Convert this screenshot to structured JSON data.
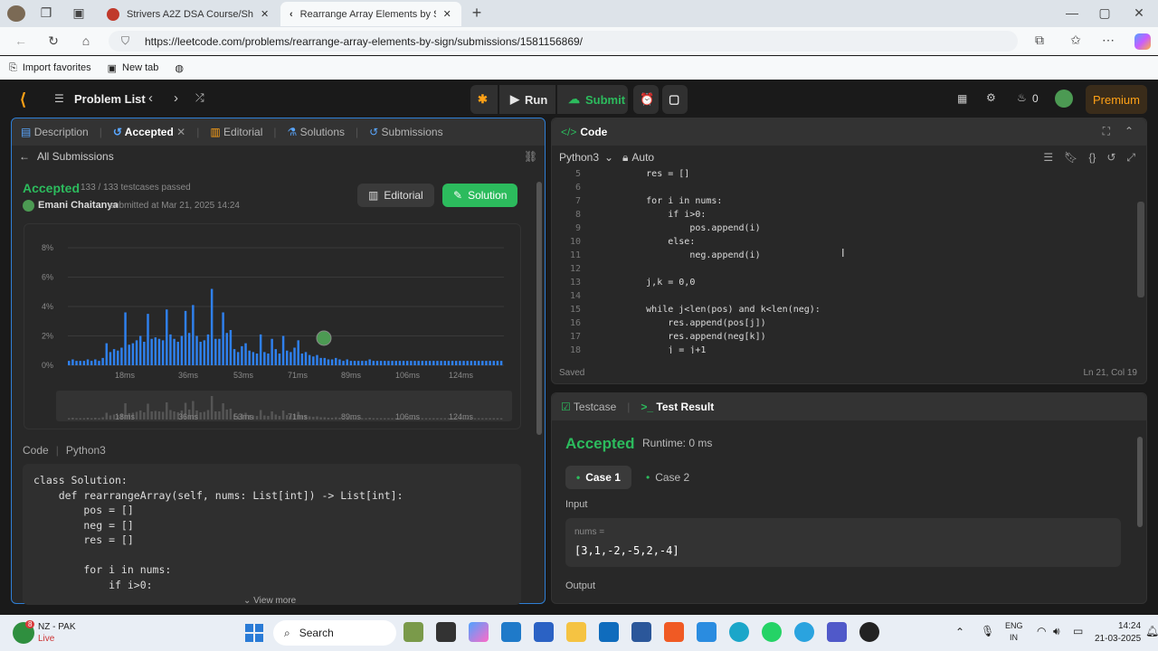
{
  "browser": {
    "tabs": [
      {
        "label": "Strivers A2Z DSA Course/Sheet - "
      },
      {
        "label": "Rearrange Array Elements by Sign"
      }
    ],
    "url": "https://leetcode.com/problems/rearrange-array-elements-by-sign/submissions/1581156869/",
    "bookmarks": {
      "import": "Import favorites",
      "newtab": "New tab"
    }
  },
  "nav": {
    "problem_list": "Problem List",
    "run": "Run",
    "submit": "Submit",
    "streak": "0",
    "premium": "Premium"
  },
  "left": {
    "tabs": [
      "Description",
      "Accepted",
      "Editorial",
      "Solutions",
      "Submissions"
    ],
    "back": "All Submissions",
    "status": "Accepted",
    "testcases": "133 / 133 testcases passed",
    "user": "Emani Chaitanya",
    "submitted": "submitted at Mar 21, 2025 14:24",
    "editorial_btn": "Editorial",
    "solution_btn": "Solution",
    "code_label": "Code",
    "lang": "Python3",
    "view_more": "View more",
    "code_lines": [
      "class Solution:",
      "    def rearrangeArray(self, nums: List[int]) -> List[int]:",
      "        pos = []",
      "        neg = []",
      "        res = []",
      "",
      "        for i in nums:",
      "            if i>0:"
    ]
  },
  "chart_data": {
    "type": "bar",
    "ylabel_ticks": [
      "0%",
      "2%",
      "4%",
      "6%",
      "8%"
    ],
    "xtick_labels": [
      "18ms",
      "36ms",
      "53ms",
      "71ms",
      "89ms",
      "106ms",
      "124ms"
    ],
    "ylim": [
      0,
      8
    ],
    "grid": true,
    "values": [
      0.3,
      0.4,
      0.3,
      0.3,
      0.3,
      0.4,
      0.3,
      0.4,
      0.3,
      0.5,
      1.5,
      0.9,
      1.1,
      1.0,
      1.2,
      3.6,
      1.4,
      1.5,
      1.7,
      2.0,
      1.6,
      3.5,
      1.8,
      1.9,
      1.8,
      1.7,
      3.8,
      2.1,
      1.8,
      1.6,
      2.0,
      3.7,
      2.2,
      4.1,
      2.0,
      1.6,
      1.7,
      2.1,
      5.2,
      1.8,
      1.8,
      3.6,
      2.2,
      2.4,
      1.1,
      0.9,
      1.3,
      1.5,
      1.0,
      0.9,
      0.8,
      2.1,
      0.9,
      0.8,
      1.8,
      1.1,
      0.8,
      2.0,
      1.0,
      0.9,
      1.2,
      1.7,
      0.8,
      0.9,
      0.7,
      0.6,
      0.7,
      0.5,
      0.5,
      0.4,
      0.4,
      0.5,
      0.4,
      0.3,
      0.4,
      0.3,
      0.3,
      0.3,
      0.3,
      0.3,
      0.4,
      0.3,
      0.3,
      0.3,
      0.3,
      0.3,
      0.3,
      0.3,
      0.3,
      0.3,
      0.3,
      0.3,
      0.3,
      0.3,
      0.3,
      0.3,
      0.3,
      0.3,
      0.3,
      0.3,
      0.3,
      0.3,
      0.3,
      0.3,
      0.3,
      0.3,
      0.3,
      0.3,
      0.3,
      0.3,
      0.3,
      0.3,
      0.3,
      0.3,
      0.3,
      0.3
    ]
  },
  "editor": {
    "title": "Code",
    "lang": "Python3",
    "auto": "Auto",
    "saved": "Saved",
    "cursor": "Ln 21, Col 19",
    "lines": [
      {
        "n": "5",
        "t": "        res = []"
      },
      {
        "n": "6",
        "t": ""
      },
      {
        "n": "7",
        "t": "        for i in nums:"
      },
      {
        "n": "8",
        "t": "            if i>0:"
      },
      {
        "n": "9",
        "t": "                pos.append(i)"
      },
      {
        "n": "10",
        "t": "            else:"
      },
      {
        "n": "11",
        "t": "                neg.append(i)"
      },
      {
        "n": "12",
        "t": ""
      },
      {
        "n": "13",
        "t": "        j,k = 0,0"
      },
      {
        "n": "14",
        "t": ""
      },
      {
        "n": "15",
        "t": "        while j<len(pos) and k<len(neg):"
      },
      {
        "n": "16",
        "t": "            res.append(pos[j])"
      },
      {
        "n": "17",
        "t": "            res.append(neg[k])"
      },
      {
        "n": "18",
        "t": "            j = j+1"
      }
    ]
  },
  "result": {
    "tab_testcase": "Testcase",
    "tab_result": "Test Result",
    "status": "Accepted",
    "runtime": "Runtime: 0 ms",
    "case1": "Case 1",
    "case2": "Case 2",
    "input_label": "Input",
    "var": "nums =",
    "value": "[3,1,-2,-5,2,-4]",
    "output_label": "Output"
  },
  "taskbar": {
    "weather": "NZ - PAK",
    "weather_sub": "Live",
    "weather_badge": "8",
    "search": "Search",
    "lang1": "ENG",
    "lang2": "IN",
    "time": "14:24",
    "date": "21-03-2025"
  },
  "colors": {
    "accent_green": "#2cbb5d",
    "leet_orange": "#ffa116",
    "bar_blue": "#2f80ed"
  }
}
